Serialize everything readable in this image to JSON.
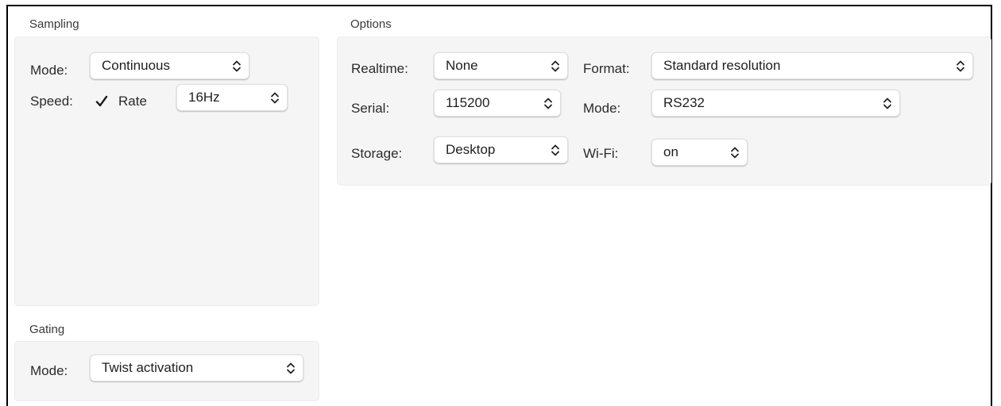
{
  "sampling": {
    "title": "Sampling",
    "mode_label": "Mode:",
    "mode_value": "Continuous",
    "speed_label": "Speed:",
    "rate_checked": true,
    "rate_label": "Rate",
    "rate_value": "16Hz"
  },
  "gating": {
    "title": "Gating",
    "mode_label": "Mode:",
    "mode_value": "Twist activation"
  },
  "options": {
    "title": "Options",
    "realtime_label": "Realtime:",
    "realtime_value": "None",
    "format_label": "Format:",
    "format_value": "Standard resolution",
    "serial_label": "Serial:",
    "serial_value": "115200",
    "serial_mode_label": "Mode:",
    "serial_mode_value": "RS232",
    "storage_label": "Storage:",
    "storage_value": "Desktop",
    "wifi_label": "Wi-Fi:",
    "wifi_value": "on"
  },
  "icons": {
    "popup_arrows": "chevron-up-down-icon",
    "checkbox": "checkmark-icon"
  }
}
